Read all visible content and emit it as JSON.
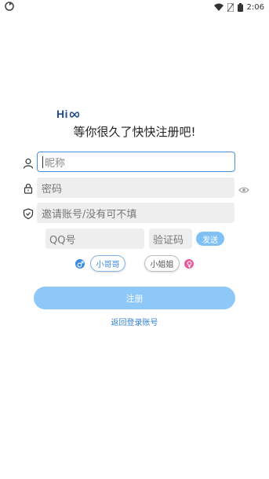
{
  "status_bar": {
    "time": "2:06",
    "icons": [
      "sync-icon",
      "wifi-icon",
      "no-sim-icon",
      "battery-icon"
    ]
  },
  "logo": {
    "text": "Hi",
    "icon": "infinity-icon",
    "color": "#244a8c"
  },
  "heading": "等你很久了快快注册吧!",
  "form": {
    "nickname": {
      "icon": "user-icon",
      "placeholder": "昵称",
      "value": ""
    },
    "password": {
      "icon": "lock-icon",
      "placeholder": "密码",
      "value": "",
      "toggle_icon": "eye-icon"
    },
    "invite": {
      "icon": "shield-icon",
      "placeholder": "邀请账号/没有可不填",
      "value": ""
    },
    "qq": {
      "placeholder": "QQ号",
      "value": ""
    },
    "captcha": {
      "placeholder": "验证码",
      "value": ""
    },
    "send_label": "发送"
  },
  "gender": {
    "male": {
      "icon": "male-icon",
      "label": "小哥哥",
      "color": "#3d8be0",
      "selected": true
    },
    "female": {
      "icon": "female-icon",
      "label": "小姐姐",
      "color": "#e85a9c",
      "selected": false
    }
  },
  "register_label": "注册",
  "back_to_login_label": "返回登录账号",
  "colors": {
    "accent": "#4a90e2",
    "button": "#8ec8f8",
    "link": "#2f7fd0"
  }
}
